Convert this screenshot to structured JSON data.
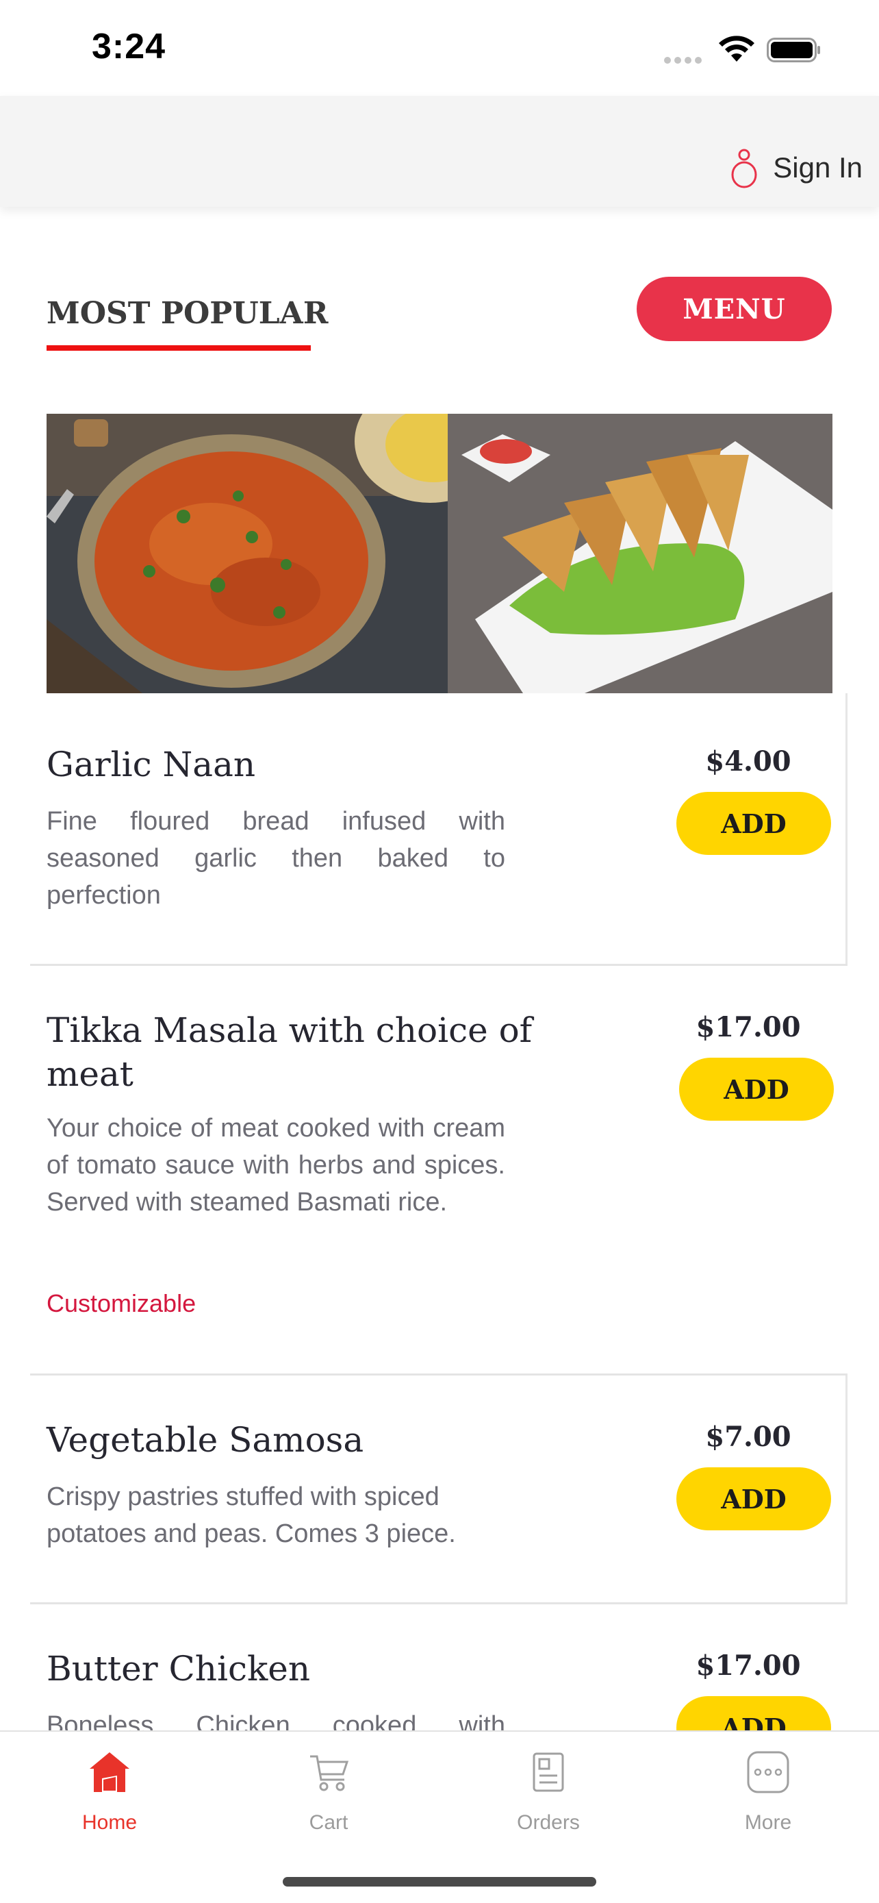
{
  "status_bar": {
    "time": "3:24"
  },
  "header": {
    "sign_in_label": "Sign In"
  },
  "section": {
    "title": "MOST POPULAR",
    "menu_button": "MENU"
  },
  "items": [
    {
      "name": "Garlic Naan",
      "description": "Fine floured bread infused with seasoned garlic then baked to perfection",
      "price": "$4.00",
      "add_label": "ADD"
    },
    {
      "name": "Tikka Masala with choice of meat",
      "description": "Your choice of meat cooked with cream of tomato sauce with herbs and spices. Served with steamed Basmati rice.",
      "price": "$17.00",
      "add_label": "ADD",
      "tag": "Customizable"
    },
    {
      "name": "Vegetable Samosa",
      "description": "Crispy pastries stuffed with spiced potatoes and peas. Comes 3 piece.",
      "price": "$7.00",
      "add_label": "ADD"
    },
    {
      "name": "Butter Chicken",
      "description": "Boneless Chicken cooked with",
      "price": "$17.00",
      "add_label": "ADD"
    }
  ],
  "tabs": [
    {
      "label": "Home",
      "icon": "home-icon",
      "active": true
    },
    {
      "label": "Cart",
      "icon": "cart-icon",
      "active": false
    },
    {
      "label": "Orders",
      "icon": "orders-icon",
      "active": false
    },
    {
      "label": "More",
      "icon": "more-icon",
      "active": false
    }
  ],
  "colors": {
    "accent_red": "#e8334a",
    "add_yellow": "#ffd500",
    "tag_red": "#d4173e",
    "active_tab": "#e8332a"
  }
}
